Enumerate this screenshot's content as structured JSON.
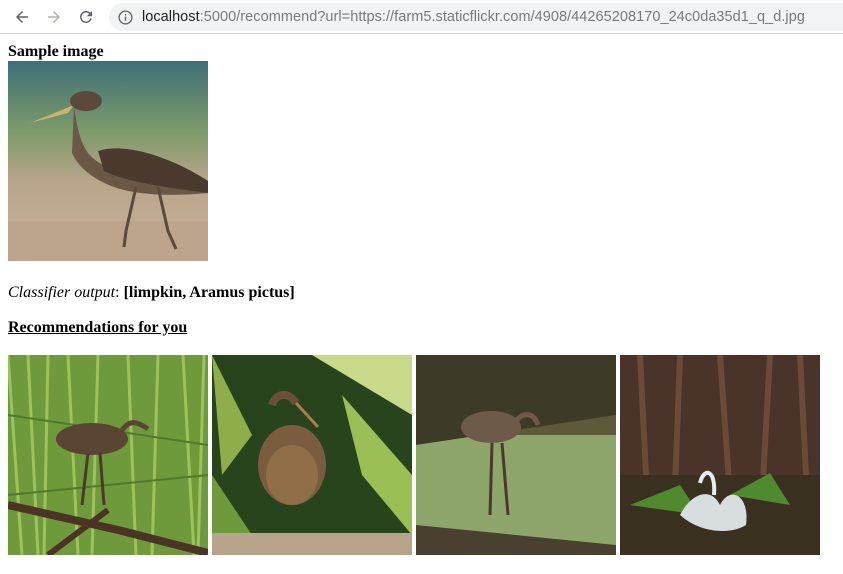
{
  "browser": {
    "url_host": "localhost",
    "url_rest": ":5000/recommend?url=https://farm5.staticflickr.com/4908/44265208170_24c0da35d1_q_d.jpg",
    "icons": [
      "back-arrow-icon",
      "forward-arrow-icon",
      "reload-icon",
      "info-icon"
    ]
  },
  "page": {
    "sample_heading": "Sample image",
    "classifier_label": "Classifier output",
    "classifier_colon": ": ",
    "classifier_value": "[limpkin, Aramus pictus]",
    "recommendations_heading": "Recommendations for you"
  }
}
